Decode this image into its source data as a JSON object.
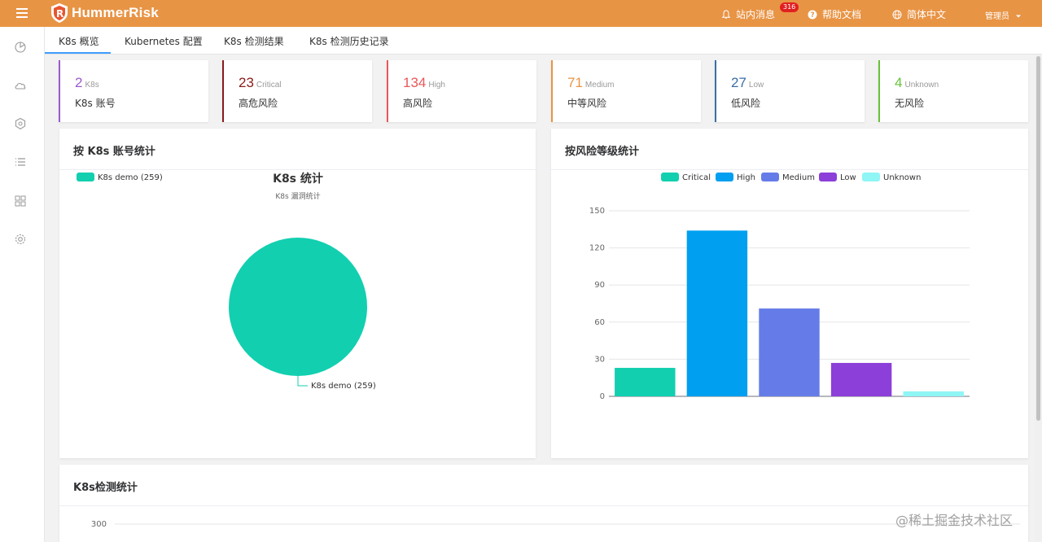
{
  "header": {
    "brand": "HummerRisk",
    "notifications_label": "站内消息",
    "notifications_count": "316",
    "help_label": "帮助文档",
    "language_label": "简体中文",
    "user_label": "管理员"
  },
  "sidebar": {
    "icons": [
      "dashboard-icon",
      "cloud-icon",
      "k8s-icon",
      "list-icon",
      "grid-icon",
      "settings-icon"
    ]
  },
  "tabs": [
    {
      "label": "K8s 概览",
      "active": true
    },
    {
      "label": "Kubernetes 配置"
    },
    {
      "label": "K8s 检测结果"
    },
    {
      "label": "K8s 检测历史记录"
    }
  ],
  "stats": [
    {
      "value": "2",
      "level": "K8s",
      "caption": "K8s 账号",
      "color": "#9b59d0"
    },
    {
      "value": "23",
      "level": "Critical",
      "caption": "高危风险",
      "color": "#8b1a1a"
    },
    {
      "value": "134",
      "level": "High",
      "caption": "高风险",
      "color": "#e8585a"
    },
    {
      "value": "71",
      "level": "Medium",
      "caption": "中等风险",
      "color": "#e89445"
    },
    {
      "value": "27",
      "level": "Low",
      "caption": "低风险",
      "color": "#3a6ea5"
    },
    {
      "value": "4",
      "level": "Unknown",
      "caption": "无风险",
      "color": "#67c23a"
    }
  ],
  "panels": {
    "by_account_title": "按 K8s 账号统计",
    "by_risk_title": "按风险等级统计",
    "detection_title": "K8s检测统计"
  },
  "chart_data": [
    {
      "type": "pie",
      "title": "K8s 统计",
      "subtitle": "K8s 漏洞统计",
      "legend": [
        "K8s demo (259)"
      ],
      "slices": [
        {
          "name": "K8s demo",
          "value": 259,
          "label": "K8s demo (259)",
          "color": "#12cfb0"
        }
      ],
      "legend_position": "top-left"
    },
    {
      "type": "bar",
      "categories": [
        "Critical",
        "High",
        "Medium",
        "Low",
        "Unknown"
      ],
      "values": [
        23,
        134,
        71,
        27,
        4
      ],
      "colors": [
        "#12cfb0",
        "#009ff0",
        "#657ce8",
        "#8c3fd9",
        "#8ff5f5"
      ],
      "legend": [
        "Critical",
        "High",
        "Medium",
        "Low",
        "Unknown"
      ],
      "yticks": [
        "0",
        "30",
        "60",
        "90",
        "120",
        "150"
      ],
      "ylim": [
        0,
        150
      ],
      "grid": true,
      "legend_position": "top"
    },
    {
      "type": "line",
      "yticks": [
        "300"
      ],
      "grid": true
    }
  ],
  "watermark": "@稀土掘金技术社区"
}
